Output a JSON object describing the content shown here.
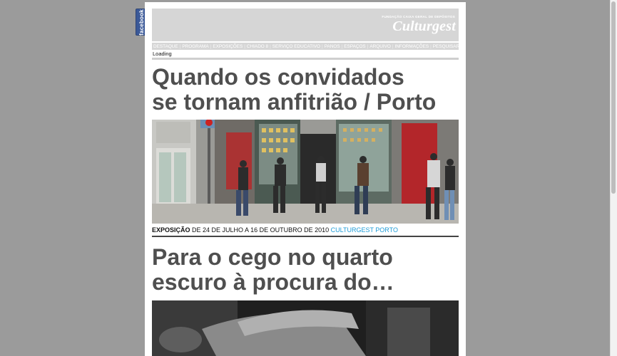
{
  "facebook_tab": "facebook",
  "header": {
    "foundation": "FUNDAÇÃO CAIXA GERAL DE DEPÓSITOS",
    "logo": "Culturgest"
  },
  "nav": [
    "DESTAQUE",
    "PROGRAMA",
    "EXPOSIÇÕES",
    "CHIADO 8",
    "SERVIÇO EDUCATIVO",
    "PANOS",
    "ESPAÇOS",
    "ARQUIVO",
    "INFORMAÇÕES",
    "PESQUISAR"
  ],
  "loading": "Loading",
  "article1": {
    "title_line1": "Quando os convidados",
    "title_line2": "se tornam anfitrião / Porto",
    "caption_kind": "EXPOSIÇÃO",
    "caption_dates": "DE 24 DE JULHO A 16 DE OUTUBRO DE 2010",
    "caption_venue": "CULTURGEST PORTO"
  },
  "article2": {
    "title_line1": "Para o cego no quarto",
    "title_line2": "escuro à procura do…"
  }
}
